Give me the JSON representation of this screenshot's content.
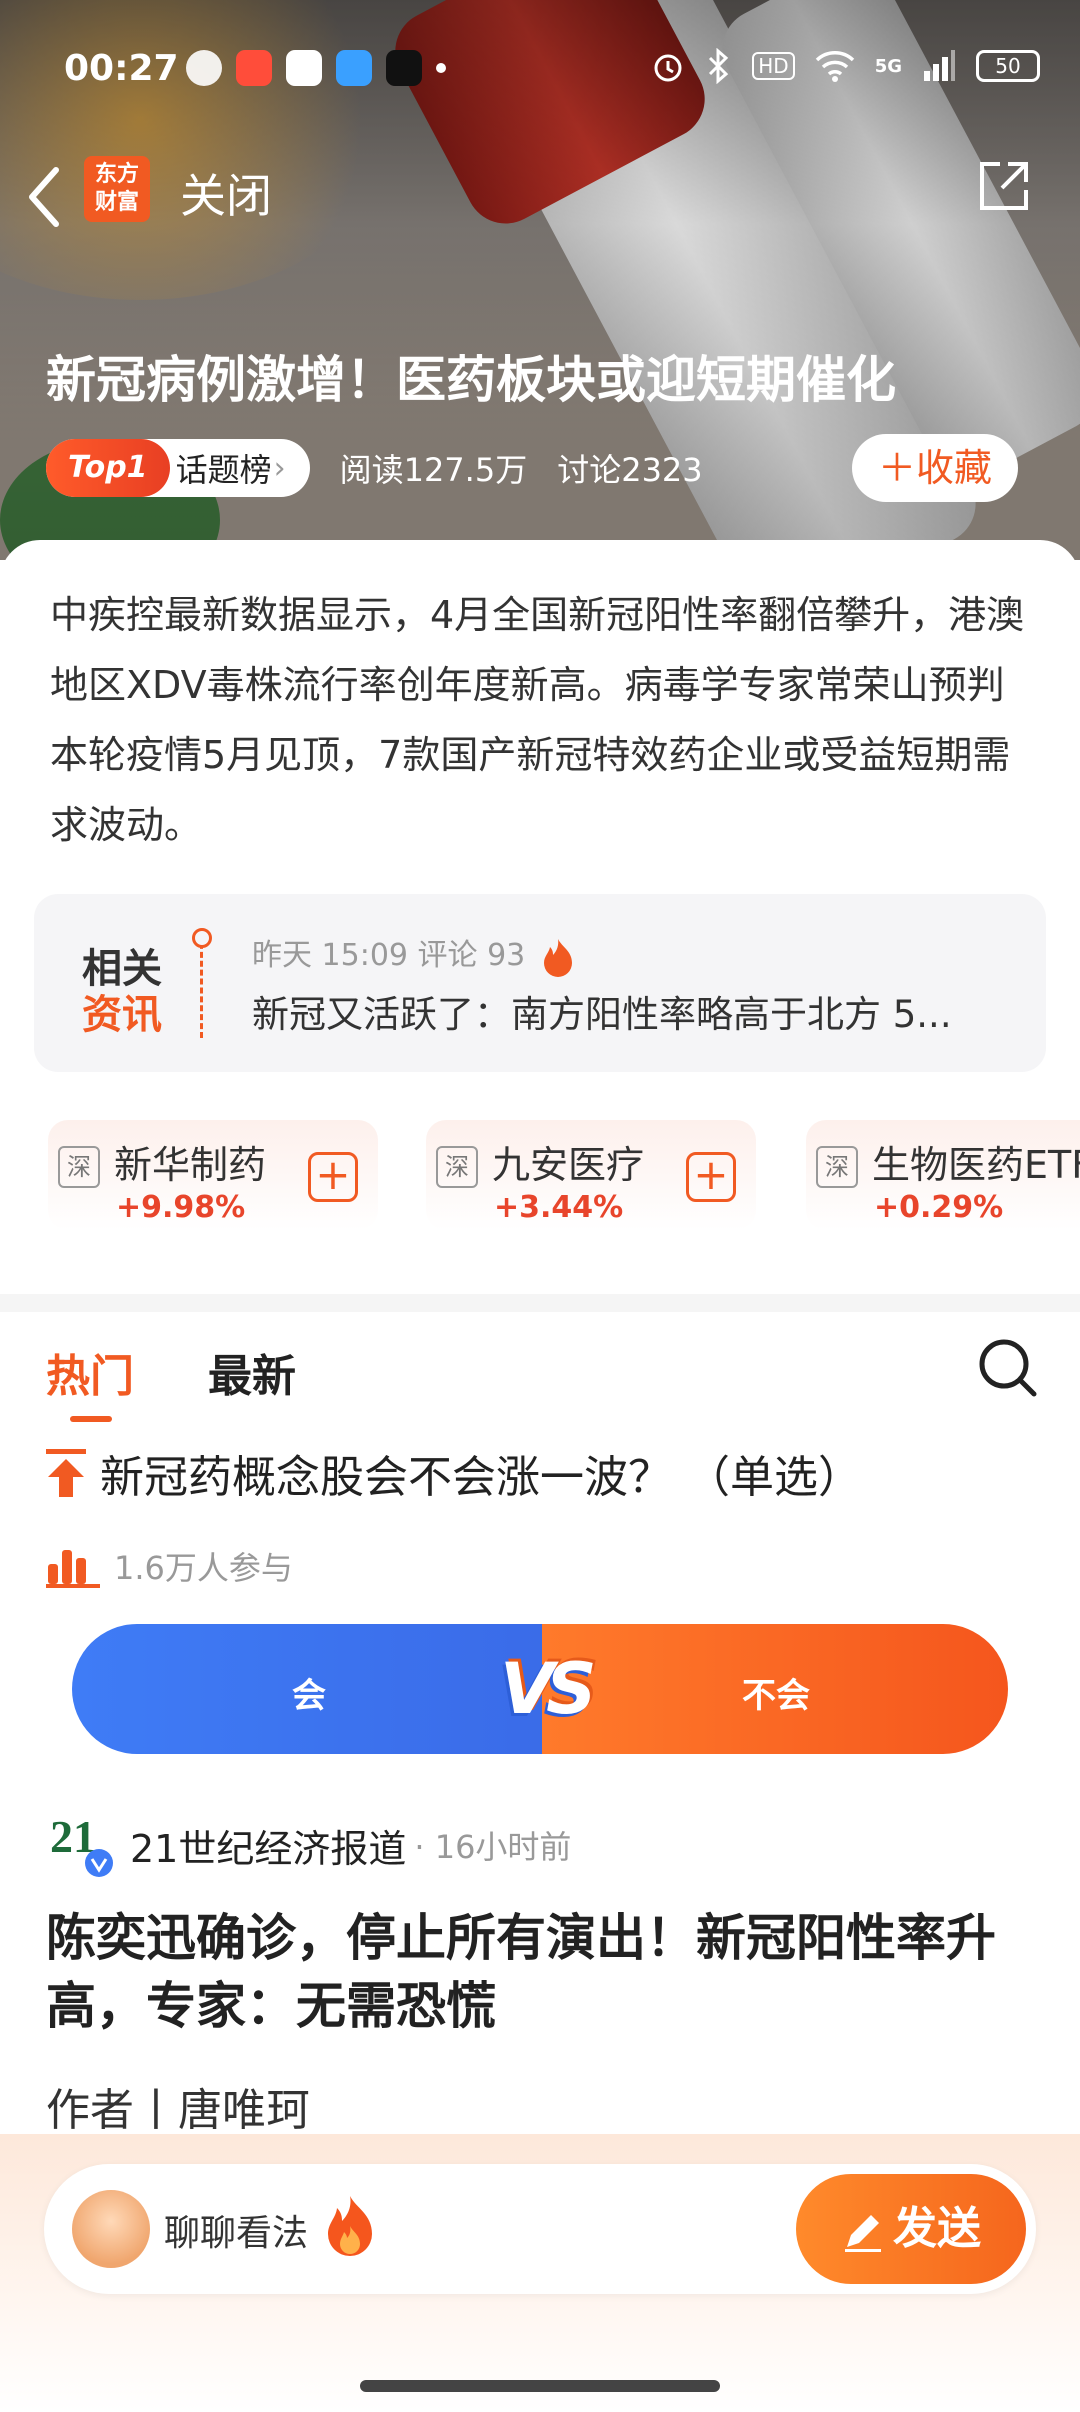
{
  "status_bar": {
    "time": "00:27",
    "battery": "50",
    "network": "5G",
    "hd": "HD"
  },
  "nav": {
    "back_icon": "chevron-left",
    "logo_text": "东方\n财富",
    "close_label": "关闭",
    "share_icon": "share-out"
  },
  "topic": {
    "title": "新冠病例激增！医药板块或迎短期催化",
    "badge": "Top1",
    "badge_suffix": "话题榜",
    "reads": "阅读127.5万",
    "discuss": "讨论2323",
    "collect_label": "收藏",
    "summary": "中疾控最新数据显示，4月全国新冠阳性率翻倍攀升，港澳地区XDV毒株流行率创年度新高。病毒学专家常荣山预判本轮疫情5月见顶，7款国产新冠特效药企业或受益短期需求波动。"
  },
  "related": {
    "label_a": "相关",
    "label_b": "资讯",
    "meta": "昨天 15:09 评论 93",
    "headline": "新冠又活跃了：南方阳性率略高于北方 5..."
  },
  "stocks": [
    {
      "market": "深",
      "name": "新华制药",
      "change": "+9.98%"
    },
    {
      "market": "深",
      "name": "九安医疗",
      "change": "+3.44%"
    },
    {
      "market": "深",
      "name": "生物医药ETF",
      "change": "+0.29%"
    }
  ],
  "tabs": {
    "hot": "热门",
    "latest": "最新"
  },
  "poll": {
    "question": "新冠药概念股会不会涨一波？ （单选）",
    "participants": "1.6万人参与",
    "option_yes": "会",
    "option_no": "不会",
    "vs": "VS"
  },
  "article": {
    "source": "21世纪经济报道",
    "time": "· 16小时前",
    "source_logo": "21",
    "title": "陈奕迅确诊，停止所有演出！新冠阳性率升高，专家：无需恐慌",
    "author": "作者丨唐唯珂"
  },
  "bottom": {
    "placeholder": "聊聊看法",
    "send_label": "发送"
  },
  "colors": {
    "accent": "#f15a22",
    "up": "#e8452b",
    "blue": "#3f7cf6"
  }
}
